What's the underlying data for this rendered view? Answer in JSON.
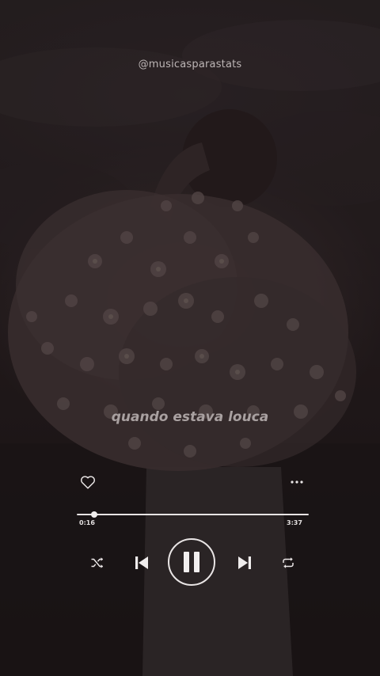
{
  "app": {
    "handle": "@musicasparastats",
    "lyric": "quando estava louca"
  },
  "player": {
    "current_time": "0:16",
    "total_time": "3:37",
    "progress": 0.074,
    "state": "playing"
  },
  "controls": {
    "like_icon": "heart-outline-icon",
    "more_icon": "more-dots-icon",
    "shuffle_icon": "shuffle-icon",
    "previous_icon": "skip-previous-icon",
    "pause_icon": "pause-icon",
    "next_icon": "skip-next-icon",
    "repeat_icon": "repeat-icon"
  },
  "colors": {
    "foreground": "#e9e5e5",
    "background": "#1a1516"
  }
}
